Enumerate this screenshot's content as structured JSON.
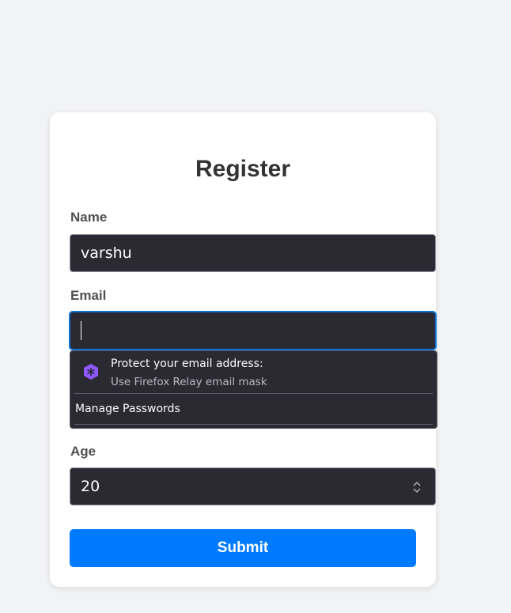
{
  "form": {
    "title": "Register",
    "name_label": "Name",
    "name_value": "varshu",
    "email_label": "Email",
    "email_value": "",
    "age_label": "Age",
    "age_value": "20",
    "submit_label": "Submit"
  },
  "autofill_popup": {
    "relay_title": "Protect your email address:",
    "relay_subtitle": "Use Firefox Relay email mask",
    "manage_passwords": "Manage Passwords",
    "relay_icon": "firefox-relay-icon"
  },
  "colors": {
    "background": "#f2f3f5",
    "card": "#ffffff",
    "field_bg": "#2b2a33",
    "focus_border": "#0b74d8",
    "submit_bg": "#007bff",
    "relay_purple": "#9059ff"
  }
}
